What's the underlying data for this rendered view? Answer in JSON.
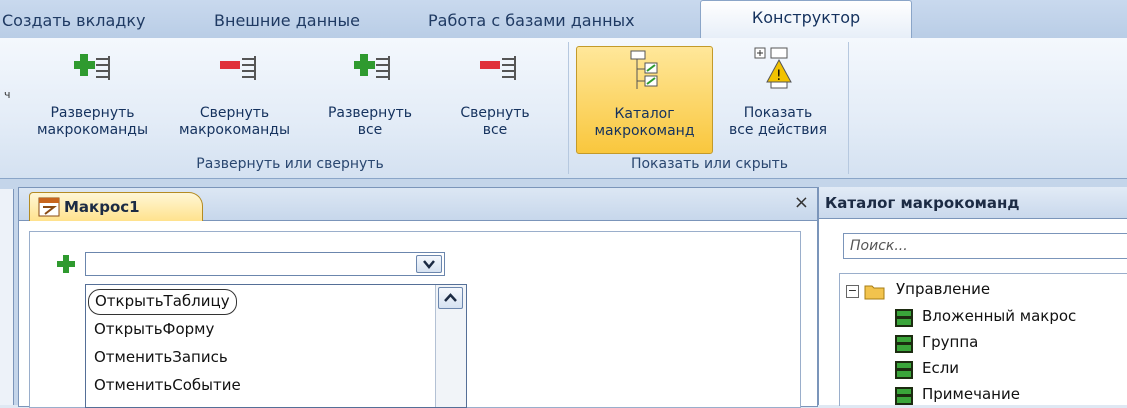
{
  "tabs": [
    {
      "label": "Создать вкладку",
      "active": false
    },
    {
      "label": "Внешние данные",
      "active": false
    },
    {
      "label": "Работа с базами данных",
      "active": false
    },
    {
      "label": "Конструктор",
      "active": true
    }
  ],
  "ribbon": {
    "left_mark": "ч",
    "groups": [
      {
        "label": "Развернуть или свернуть",
        "buttons": [
          {
            "line1": "Развернуть",
            "line2": "макрокоманды",
            "icon": "expand-actions-icon"
          },
          {
            "line1": "Свернуть",
            "line2": "макрокоманды",
            "icon": "collapse-actions-icon"
          },
          {
            "line1": "Развернуть",
            "line2": "все",
            "icon": "expand-all-icon"
          },
          {
            "line1": "Свернуть",
            "line2": "все",
            "icon": "collapse-all-icon"
          }
        ]
      },
      {
        "label": "Показать или скрыть",
        "buttons": [
          {
            "line1": "Каталог",
            "line2": "макрокоманд",
            "icon": "action-catalog-icon",
            "selected": true
          },
          {
            "line1": "Показать",
            "line2": "все действия",
            "icon": "show-all-actions-icon"
          }
        ]
      }
    ]
  },
  "document": {
    "tab_title": "Макрос1",
    "close_glyph": "×",
    "add_glyph": "+",
    "combo_value": "",
    "dropdown_items": [
      {
        "label": "ОткрытьТаблицу",
        "highlighted": true
      },
      {
        "label": "ОткрытьФорму",
        "highlighted": false
      },
      {
        "label": "ОтменитьЗапись",
        "highlighted": false
      },
      {
        "label": "ОтменитьСобытие",
        "highlighted": false
      }
    ]
  },
  "catalog": {
    "title": "Каталог макрокоманд",
    "search_placeholder": "Поиск...",
    "tree": {
      "expander": "−",
      "folder": "Управление",
      "items": [
        "Вложенный макрос",
        "Группа",
        "Если",
        "Примечание"
      ]
    }
  },
  "colors": {
    "accent_selected": "#f9c73d",
    "plus_green": "#2f9a2f",
    "minus_red": "#e0303a",
    "item_icon_green": "#3aa53a"
  }
}
